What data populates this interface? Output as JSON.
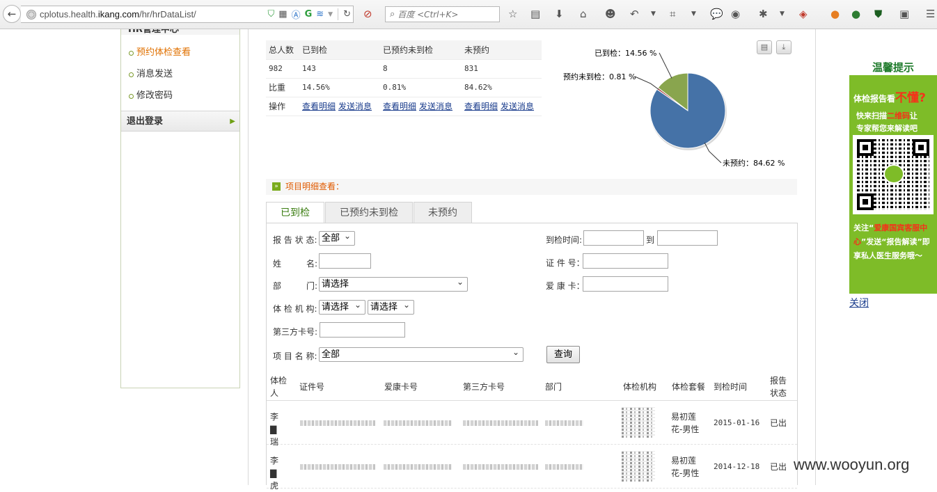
{
  "browser": {
    "url_prefix": "cplotus.health.",
    "url_domain": "ikang.com",
    "url_path": "/hr/hrDataList/",
    "search_placeholder": "百度 <Ctrl+K>"
  },
  "sidebar": {
    "items": [
      {
        "label": "预约体检查看",
        "active": true
      },
      {
        "label": "消息发送"
      },
      {
        "label": "修改密码"
      }
    ],
    "logout_label": "退出登录"
  },
  "summary": {
    "headers": [
      "总人数",
      "已到检",
      "已预约未到检",
      "未预约"
    ],
    "counts": [
      "982",
      "143",
      "8",
      "831"
    ],
    "ratio_label": "比重",
    "ratios": [
      "14.56%",
      "0.81%",
      "84.62%"
    ],
    "action_label": "操作",
    "view_link": "查看明细",
    "send_link": "发送消息"
  },
  "chart_data": {
    "type": "pie",
    "categories": [
      "已到检",
      "预约未到检",
      "未预约"
    ],
    "values": [
      14.56,
      0.81,
      84.62
    ],
    "colors": [
      "#89a54e",
      "#aa4643",
      "#4572a7"
    ],
    "labels": [
      "已到检：14.56 %",
      "预约未到检：0.81 %",
      "未预约：84.62 %"
    ]
  },
  "section_title": "项目明细查看：",
  "tabs": [
    {
      "label": "已到检",
      "active": true
    },
    {
      "label": "已预约未到检"
    },
    {
      "label": "未预约"
    }
  ],
  "form": {
    "report_status_label": "报 告 状 态:",
    "report_status_value": "全部",
    "name_label_a": "姓",
    "name_label_b": "名:",
    "dept_label_a": "部",
    "dept_label_b": "门:",
    "dept_value": "请选择",
    "org_label": "体 检 机 构:",
    "org_value1": "请选择",
    "org_value2": "请选择",
    "third_card_label": "第三方卡号:",
    "item_name_label": "项 目 名 称:",
    "item_name_value": "全部",
    "arrive_time_label": "到检时间:",
    "to_label": "到",
    "id_no_label": "证 件 号：",
    "ikang_card_label": "爱 康 卡：",
    "query_button": "查询"
  },
  "results": {
    "headers": [
      "体检人",
      "证件号",
      "爱康卡号",
      "第三方卡号",
      "部门",
      "体检机构",
      "体检套餐",
      "到检时间",
      "报告状态"
    ],
    "rows": [
      {
        "name": "李▇瑞",
        "package": "易初莲花-男性",
        "date": "2015-01-16",
        "status": "已出"
      },
      {
        "name": "李▇虎",
        "package": "易初莲花-男性",
        "date": "2014-12-18",
        "status": "已出"
      }
    ]
  },
  "ad": {
    "title": "温馨提示",
    "line1": "体检报告看",
    "line1_big": "不懂?",
    "line2a": "快来扫描",
    "line2_hl": "二维码",
    "line2b": "让",
    "line3": "专家帮您来解读吧",
    "line4a": "关注“",
    "line4_hl": "爱康国宾客服中心",
    "line4b": "”发送“报告解读”即享私人医生服务哦～",
    "close": "关闭"
  },
  "watermark": "www.wooyun.org"
}
